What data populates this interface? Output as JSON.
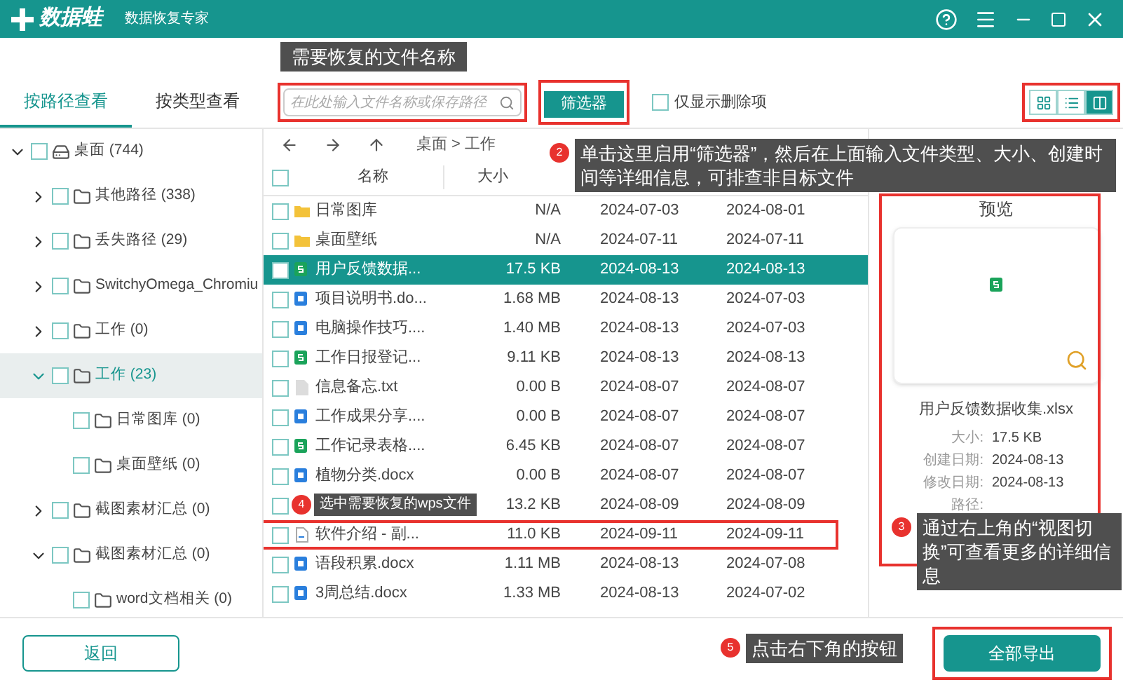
{
  "app": {
    "brand": "数据蛙",
    "subtitle": "数据恢复专家"
  },
  "view_tabs": [
    {
      "label": "按路径查看",
      "selected": true
    },
    {
      "label": "按类型查看",
      "selected": false
    }
  ],
  "search": {
    "placeholder": "在此处输入文件名称或保存路径"
  },
  "filter_button": "筛选器",
  "deleted_only": {
    "label": "仅显示删除项",
    "checked": false
  },
  "view_modes": [
    {
      "kind": "grid",
      "selected": false
    },
    {
      "kind": "list",
      "selected": false
    },
    {
      "kind": "detail",
      "selected": true
    }
  ],
  "tree": [
    {
      "label": "桌面 (744)",
      "kind": "drive",
      "checked": false,
      "selected": false,
      "expandable": true,
      "expanded": true,
      "children": [
        {
          "label": "其他路径 (338)",
          "kind": "folder",
          "checked": false,
          "selected": false,
          "expandable": true,
          "expanded": false
        },
        {
          "label": "丢失路径 (29)",
          "kind": "folder",
          "checked": false,
          "selected": false,
          "expandable": true,
          "expanded": false
        },
        {
          "label": "SwitchyOmega_Chromiu",
          "kind": "folder",
          "checked": false,
          "selected": false,
          "expandable": true,
          "expanded": false
        },
        {
          "label": "工作 (0)",
          "kind": "folder",
          "checked": false,
          "selected": false,
          "expandable": true,
          "expanded": false
        },
        {
          "label": "工作 (23)",
          "kind": "folder",
          "checked": false,
          "selected": true,
          "expandable": true,
          "expanded": true,
          "children": [
            {
              "label": "日常图库 (0)",
              "kind": "folder",
              "checked": false,
              "selected": false,
              "expandable": false
            },
            {
              "label": "桌面壁纸 (0)",
              "kind": "folder",
              "checked": false,
              "selected": false,
              "expandable": false
            }
          ]
        },
        {
          "label": "截图素材汇总 (0)",
          "kind": "folder",
          "checked": false,
          "selected": false,
          "expandable": true,
          "expanded": false
        },
        {
          "label": "截图素材汇总 (0)",
          "kind": "folder",
          "checked": false,
          "selected": false,
          "expandable": true,
          "expanded": true,
          "children": [
            {
              "label": "word文档相关 (0)",
              "kind": "folder",
              "checked": false,
              "selected": false,
              "expandable": false
            }
          ]
        }
      ]
    }
  ],
  "breadcrumb": "桌面 > 工作",
  "table": {
    "columns": [
      "名称",
      "大小"
    ],
    "all_checked": false,
    "rows": [
      {
        "kind": "folder",
        "name": "日常图库",
        "size": "N/A",
        "created": "2024-07-03",
        "modified": "2024-08-01",
        "selected": false,
        "checked": false,
        "marked": false
      },
      {
        "kind": "folder",
        "name": "桌面壁纸",
        "size": "N/A",
        "created": "2024-07-11",
        "modified": "2024-07-11",
        "selected": false,
        "checked": false,
        "marked": false
      },
      {
        "kind": "sheet",
        "name": "用户反馈数据...",
        "size": "17.5 KB",
        "created": "2024-08-13",
        "modified": "2024-08-13",
        "selected": true,
        "checked": false,
        "marked": false
      },
      {
        "kind": "doc",
        "name": "项目说明书.do...",
        "size": "1.68 MB",
        "created": "2024-08-13",
        "modified": "2024-07-03",
        "selected": false,
        "checked": false,
        "marked": false
      },
      {
        "kind": "doc",
        "name": "电脑操作技巧....",
        "size": "1.40 MB",
        "created": "2024-08-13",
        "modified": "2024-07-03",
        "selected": false,
        "checked": false,
        "marked": false
      },
      {
        "kind": "sheet",
        "name": "工作日报登记...",
        "size": "9.11 KB",
        "created": "2024-08-13",
        "modified": "2024-08-13",
        "selected": false,
        "checked": false,
        "marked": false
      },
      {
        "kind": "text",
        "name": "信息备忘.txt",
        "size": "0.00 B",
        "created": "2024-08-07",
        "modified": "2024-08-07",
        "selected": false,
        "checked": false,
        "marked": false
      },
      {
        "kind": "doc",
        "name": "工作成果分享....",
        "size": "0.00 B",
        "created": "2024-08-07",
        "modified": "2024-08-07",
        "selected": false,
        "checked": false,
        "marked": false
      },
      {
        "kind": "sheet",
        "name": "工作记录表格....",
        "size": "6.45 KB",
        "created": "2024-08-07",
        "modified": "2024-08-07",
        "selected": false,
        "checked": false,
        "marked": false
      },
      {
        "kind": "doc",
        "name": "植物分类.docx",
        "size": "0.00 B",
        "created": "2024-08-07",
        "modified": "2024-08-07",
        "selected": false,
        "checked": false,
        "marked": false
      },
      {
        "size": "13.2 KB",
        "created": "2024-08-09",
        "modified": "2024-08-09",
        "selected": false,
        "checked": false,
        "marked": false
      },
      {
        "kind": "blank",
        "name": "软件介绍 - 副...",
        "size": "11.0 KB",
        "created": "2024-09-11",
        "modified": "2024-09-11",
        "selected": false,
        "checked": false,
        "marked": true
      },
      {
        "kind": "doc",
        "name": "语段积累.docx",
        "size": "1.11 MB",
        "created": "2024-08-13",
        "modified": "2024-07-08",
        "selected": false,
        "checked": false,
        "marked": false
      },
      {
        "kind": "doc",
        "name": "3周总结.docx",
        "size": "1.33 MB",
        "created": "2024-08-13",
        "modified": "2024-07-02",
        "selected": false,
        "checked": false,
        "marked": false
      }
    ]
  },
  "preview": {
    "title": "预览",
    "file_name": "用户反馈数据收集.xlsx",
    "details": [
      {
        "label": "大小:",
        "value": "17.5 KB"
      },
      {
        "label": "创建日期:",
        "value": "2024-08-13"
      },
      {
        "label": "修改日期:",
        "value": "2024-08-13"
      },
      {
        "label": "路径:"
      }
    ]
  },
  "back_button": "返回",
  "export_button": "全部导出",
  "callouts": [
    {
      "text": "需要恢复的文件名称"
    },
    {
      "number": "2",
      "text": "单击这里启用“筛选器”，然后在上面输入文件类型、大小、创建时间等详细信息，可排查非目标文件"
    },
    {
      "number": "3",
      "text": "通过右上角的“视图切换”可查看更多的详细信息"
    },
    {
      "number": "4",
      "text": "选中需要恢复的wps文件"
    },
    {
      "number": "5",
      "text": "点击右下角的按钮"
    }
  ]
}
